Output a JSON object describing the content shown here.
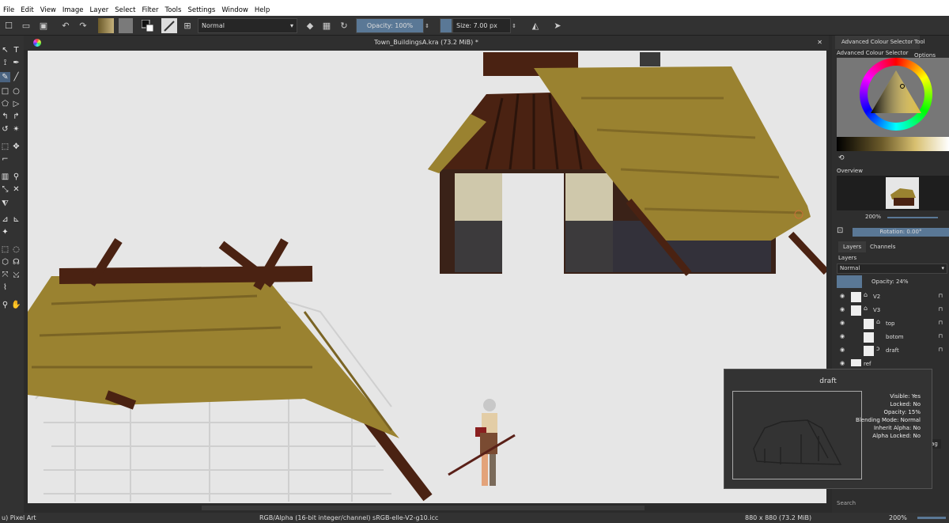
{
  "menu": [
    "File",
    "Edit",
    "View",
    "Image",
    "Layer",
    "Select",
    "Filter",
    "Tools",
    "Settings",
    "Window",
    "Help"
  ],
  "toolbar": {
    "blend_mode": "Normal",
    "opacity": "Opacity: 100%",
    "size": "Size: 7.00 px"
  },
  "document": {
    "tab_title": "Town_BuildingsA.kra (73.2 MiB) *"
  },
  "dock": {
    "tabs": [
      "Advanced Colour Selector",
      "Tool Options"
    ],
    "panel_title": "Advanced Colour Selector",
    "overview_label": "Overview",
    "zoom": "200%",
    "rotation": "Rotation: 0.00°",
    "layers_tabs": [
      "Layers",
      "Channels"
    ],
    "layers_label": "Layers",
    "blend": "Normal",
    "opacity": "Opacity:  24%",
    "layers": [
      {
        "name": "V2",
        "indent": 0
      },
      {
        "name": "V3",
        "indent": 0
      },
      {
        "name": "top",
        "indent": 1
      },
      {
        "name": "botom",
        "indent": 1
      },
      {
        "name": "draft",
        "indent": 1
      },
      {
        "name": "ref",
        "indent": 0
      }
    ],
    "tag_label": "Tag",
    "search_placeholder": "Search"
  },
  "tooltip": {
    "title": "draft",
    "visible": "Visible: Yes",
    "locked": "Locked: No",
    "opacity": "Opacity: 15%",
    "blending": "Blending Mode: Normal",
    "inherit": "Inherit Alpha: No",
    "alpha_locked": "Alpha Locked: No"
  },
  "status": {
    "left": "u) Pixel Art",
    "color_space": "RGB/Alpha (16-bit integer/channel)  sRGB-elle-V2-g10.icc",
    "dimensions": "880 x 880 (73.2 MiB)",
    "zoom": "200%"
  },
  "colors": {
    "thatch": "#9a8230",
    "wood": "#4a2212",
    "canvas": "#e6e6e6",
    "accent": "#5a7896"
  }
}
